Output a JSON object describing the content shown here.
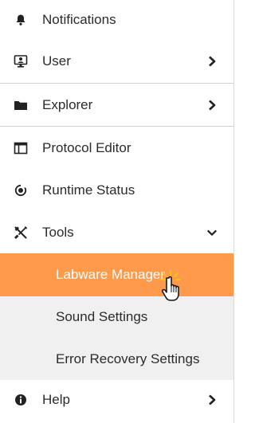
{
  "menu": {
    "items": [
      {
        "label": "Notifications",
        "icon": "bell-icon"
      },
      {
        "label": "User",
        "icon": "user-monitor-icon",
        "has_chevron": true
      },
      {
        "label": "Explorer",
        "icon": "folder-icon",
        "has_chevron": true
      },
      {
        "label": "Protocol Editor",
        "icon": "protocol-editor-icon"
      },
      {
        "label": "Runtime Status",
        "icon": "runtime-status-icon"
      },
      {
        "label": "Tools",
        "icon": "tools-icon",
        "expanded": true
      },
      {
        "label": "Help",
        "icon": "info-icon",
        "has_chevron": true
      }
    ],
    "tools_submenu": [
      {
        "label": "Labware Manager",
        "active": true
      },
      {
        "label": "Sound Settings"
      },
      {
        "label": "Error Recovery Settings"
      }
    ]
  },
  "colors": {
    "active_bg": "#ff9a4d",
    "submenu_bg": "#f0f0f0",
    "text": "#2b2b2b",
    "divider": "#cfcfcf"
  }
}
